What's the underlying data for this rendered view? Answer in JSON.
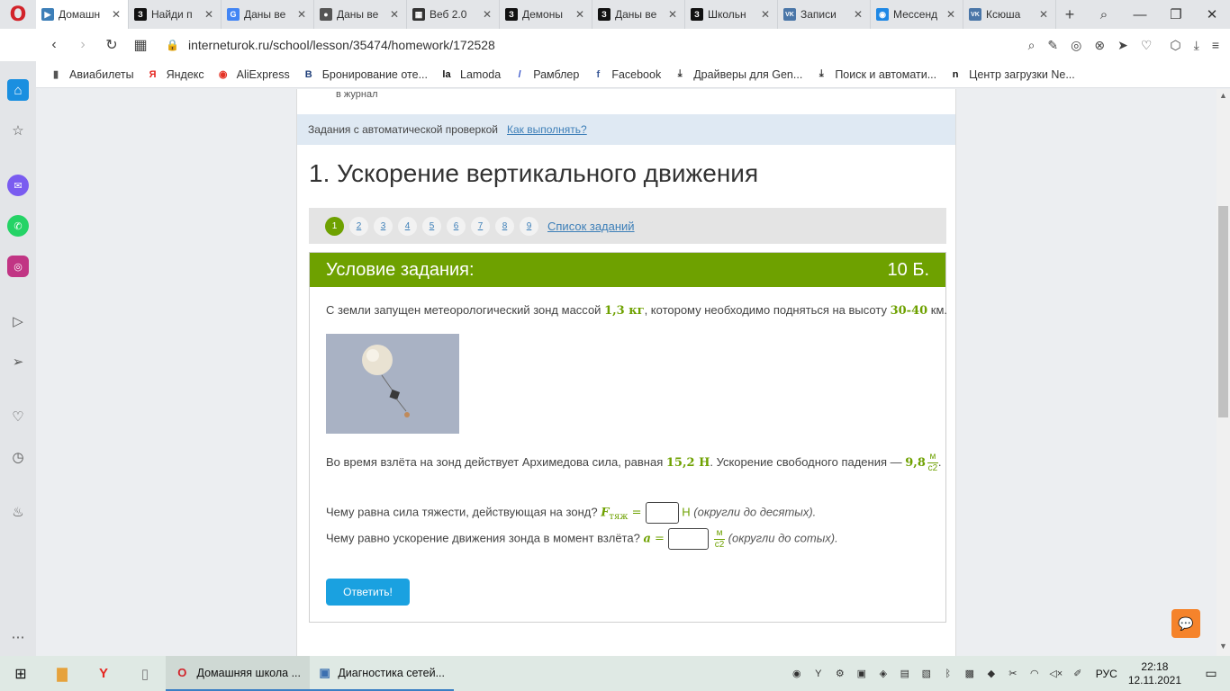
{
  "browser": {
    "tabs": [
      {
        "label": "Домашн",
        "icon": "play-icon",
        "color": "#3d7fb8",
        "active": true
      },
      {
        "label": "Найди п",
        "icon": "znanija-icon",
        "color": "#111111"
      },
      {
        "label": "Даны ве",
        "icon": "google-icon",
        "color": "#4285f4"
      },
      {
        "label": "Даны ве",
        "icon": "globe-icon",
        "color": "#555555"
      },
      {
        "label": "Веб 2.0",
        "icon": "grid-icon",
        "color": "#333333"
      },
      {
        "label": "Демоны",
        "icon": "znanija-icon",
        "color": "#111111"
      },
      {
        "label": "Даны ве",
        "icon": "znanija-icon",
        "color": "#111111"
      },
      {
        "label": "Школьн",
        "icon": "znanija-icon",
        "color": "#111111"
      },
      {
        "label": "Записи",
        "icon": "vk-icon",
        "color": "#4a76a8"
      },
      {
        "label": "Мессенд",
        "icon": "messenger-icon",
        "color": "#1e88e5"
      },
      {
        "label": "Ксюша",
        "icon": "vk-icon",
        "color": "#4a76a8"
      }
    ],
    "new_tab": "+",
    "url": "interneturok.ru/school/lesson/35474/homework/172528",
    "bookmarks": [
      {
        "label": "Авиабилеты",
        "icon": "file-icon",
        "glyph": "▮",
        "color": "#555555"
      },
      {
        "label": "Яндекс",
        "icon": "yandex-icon",
        "glyph": "Я",
        "color": "#e52620"
      },
      {
        "label": "AliExpress",
        "icon": "aliexpress-icon",
        "glyph": "◉",
        "color": "#e43225"
      },
      {
        "label": "Бронирование оте...",
        "icon": "booking-icon",
        "glyph": "B",
        "color": "#1f3f7a"
      },
      {
        "label": "Lamoda",
        "icon": "lamoda-icon",
        "glyph": "la",
        "color": "#111111"
      },
      {
        "label": "Рамблер",
        "icon": "rambler-icon",
        "glyph": "/",
        "color": "#3552c8"
      },
      {
        "label": "Facebook",
        "icon": "facebook-icon",
        "glyph": "f",
        "color": "#3b5998"
      },
      {
        "label": "Драйверы для Gen...",
        "icon": "download-icon",
        "glyph": "⤓",
        "color": "#333333"
      },
      {
        "label": "Поиск и автомати...",
        "icon": "download-icon",
        "glyph": "⤓",
        "color": "#333333"
      },
      {
        "label": "Центр загрузки Ne...",
        "icon": "netgear-icon",
        "glyph": "n",
        "color": "#111111"
      }
    ]
  },
  "page": {
    "journal_text": "в журнал",
    "autocheck_label": "Задания с автоматической проверкой",
    "howto_link": "Как выполнять?",
    "title": "1. Ускорение вертикального движения",
    "pages": [
      "1",
      "2",
      "3",
      "4",
      "5",
      "6",
      "7",
      "8",
      "9"
    ],
    "current_page": "1",
    "task_list_link": "Список заданий",
    "task": {
      "header": "Условие задания:",
      "points": "10 Б.",
      "p1_a": "С земли запущен метеорологический зонд массой ",
      "mass": "1,3 кг",
      "p1_b": ", которому необходимо подняться на высоту ",
      "height": "30-40",
      "p1_c": " км.",
      "p2_a": "Во время взлёта на зонд действует Архимедова сила, равная ",
      "force": "15,2 Н",
      "p2_b": ". Ускорение свободного падения — ",
      "g": "9,8",
      "g_unit_num": "м",
      "g_unit_den": "с2",
      "p2_c": ".",
      "q1": "Чему равна сила тяжести, действующая на зонд? ",
      "q1_var": "F",
      "q1_sub": "тяж",
      "eq": " = ",
      "q1_unit": "Н",
      "q1_hint": "(округли до десятых).",
      "q2": "Чему равно ускорение движения зонда в момент взлёта? ",
      "q2_var": "a",
      "q2_unit_num": "м",
      "q2_unit_den": "с2",
      "q2_hint": "(округли до сотых).",
      "submit": "Ответить!"
    }
  },
  "taskbar": {
    "apps": [
      {
        "label": "Домашняя школа ...",
        "icon": "opera-icon",
        "active": true
      },
      {
        "label": "Диагностика сетей...",
        "icon": "network-diagnostics-icon",
        "active": false
      }
    ],
    "lang": "РУС",
    "time": "22:18",
    "date": "12.11.2021"
  },
  "colors": {
    "accent_green": "#6ea100",
    "link_blue": "#3d7fb8",
    "button_blue": "#1aa1e0"
  }
}
